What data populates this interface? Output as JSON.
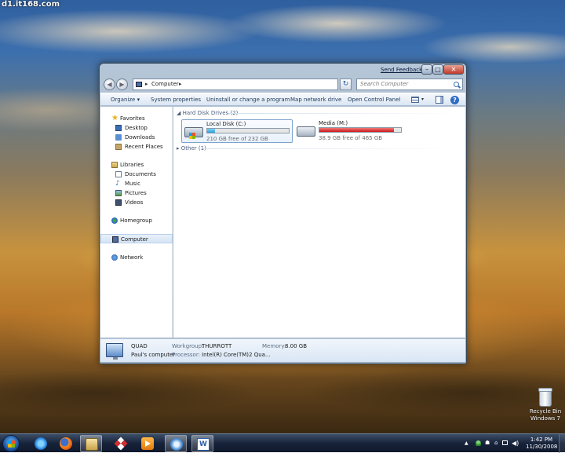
{
  "watermark": "d1.it168.com",
  "desktop": {
    "recycle_bin_label": "Recycle Bin",
    "os_label": "Windows 7"
  },
  "window": {
    "send_feedback": "Send Feedback",
    "address": {
      "separator": "▸",
      "location": "Computer",
      "dropdown": "▾"
    },
    "search": {
      "placeholder": "Search Computer"
    },
    "commands": {
      "organize": "Organize ▾",
      "system_properties": "System properties",
      "uninstall": "Uninstall or change a program",
      "map_network_drive": "Map network drive",
      "open_control_panel": "Open Control Panel"
    },
    "navigation": {
      "favorites": "Favorites",
      "desktop": "Desktop",
      "downloads": "Downloads",
      "recent_places": "Recent Places",
      "libraries": "Libraries",
      "documents": "Documents",
      "music": "Music",
      "pictures": "Pictures",
      "videos": "Videos",
      "homegroup": "Homegroup",
      "computer": "Computer",
      "network": "Network"
    },
    "content": {
      "hard_disk_header": "Hard Disk Drives (2)",
      "other_header": "Other (1)",
      "drives": [
        {
          "name": "Local Disk (C:)",
          "free_text": "210 GB free of 232 GB",
          "used_fraction": 0.095,
          "bar_color": "#28a0d6"
        },
        {
          "name": "Media (M:)",
          "free_text": "38.9 GB free of 465 GB",
          "used_fraction": 0.916,
          "bar_color": "#cc1818"
        }
      ]
    },
    "details": {
      "computer_name": "QUAD",
      "owner": "Paul's computer",
      "workgroup_label": "Workgroup:",
      "workgroup_value": "THURROTT",
      "memory_label": "Memory:",
      "memory_value": "8.00 GB",
      "processor_label": "Processor:",
      "processor_value": "Intel(R) Core(TM)2 Qua..."
    }
  },
  "taskbar": {
    "clock_time": "1:42 PM",
    "clock_date": "11/30/2008",
    "word_icon_letter": "W"
  },
  "icons": [
    "start-button",
    "ie-icon",
    "firefox-icon",
    "explorer-icon",
    "media-player-icon",
    "word-icon",
    "search-icon",
    "help-icon",
    "recycle-bin-icon"
  ],
  "colors": {
    "window_chrome": "#a0b4c8",
    "command_text": "#1e395b",
    "drive_c_bar": "#28a0d6",
    "drive_m_bar": "#cc1818",
    "taskbar": "#17233a"
  }
}
